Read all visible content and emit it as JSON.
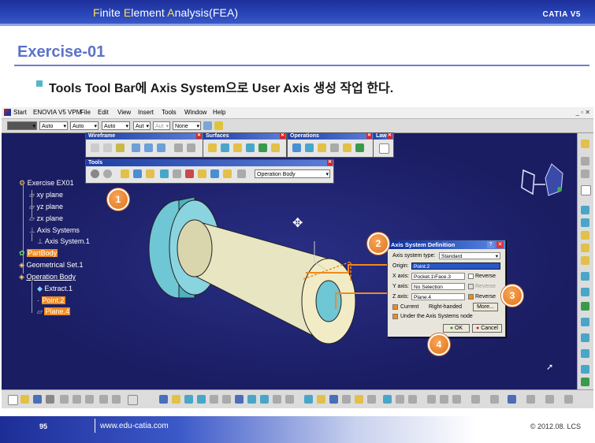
{
  "header": {
    "title_parts": [
      "F",
      "inite ",
      "E",
      "lement ",
      "A",
      "nalysis(FEA)"
    ],
    "brand": "CATIA V5"
  },
  "exercise_title": "Exercise-01",
  "instruction": "Tools Tool Bar에 Axis System으로 User Axis 생성 작업 한다.",
  "app": {
    "menu": [
      "Start",
      "ENOVIA V5 VPM",
      "File",
      "Edit",
      "View",
      "Insert",
      "Tools",
      "Window",
      "Help"
    ],
    "combos": [
      "",
      "Auto",
      "Auto",
      "Auto",
      "Aut",
      "Aut",
      "None"
    ],
    "toolbars": {
      "wireframe": "Wireframe",
      "surfaces": "Surfaces",
      "operations": "Operations",
      "law": "Law",
      "tools": "Tools",
      "tools_combo": "Operation Body"
    },
    "tree": [
      {
        "label": "Exercise EX01",
        "highlight": false
      },
      {
        "label": "xy plane",
        "highlight": false
      },
      {
        "label": "yz plane",
        "highlight": false
      },
      {
        "label": "zx plane",
        "highlight": false
      },
      {
        "label": "Axis Systems",
        "highlight": false
      },
      {
        "label": "Axis System.1",
        "highlight": false
      },
      {
        "label": "PartBody",
        "highlight": true
      },
      {
        "label": "Geometrical Set.1",
        "highlight": false
      },
      {
        "label": "Operation Body",
        "highlight": false
      },
      {
        "label": "Extract.1",
        "highlight": false
      },
      {
        "label": "Point.2",
        "highlight": true
      },
      {
        "label": "Plane.4",
        "highlight": true
      }
    ],
    "dialog": {
      "title": "Axis System Definition",
      "type_label": "Axis system type:",
      "type_value": "Standard",
      "origin_label": "Origin:",
      "origin_value": "Point.2",
      "x_label": "X axis:",
      "x_value": "Pocket.1\\Face.3",
      "y_label": "Y axis:",
      "y_value": "No Selection",
      "z_label": "Z axis:",
      "z_value": "Plane.4",
      "reverse": "Reverse",
      "current": "Current",
      "right_handed": "Right-handed",
      "more": "More...",
      "under_node": "Under the Axis Systems node",
      "ok": "OK",
      "cancel": "Cancel"
    },
    "callouts": [
      "1",
      "2",
      "3",
      "4"
    ]
  },
  "footer": {
    "page": "95",
    "url": "www.edu-catia.com",
    "copyright": "© 2012.08. LCS"
  },
  "colors": {
    "header_blue": "#2946b8",
    "title_blue": "#5b73c9",
    "viewport": "#1c1f66",
    "callout_orange": "#e27417",
    "highlight_orange": "#f18a1e"
  }
}
